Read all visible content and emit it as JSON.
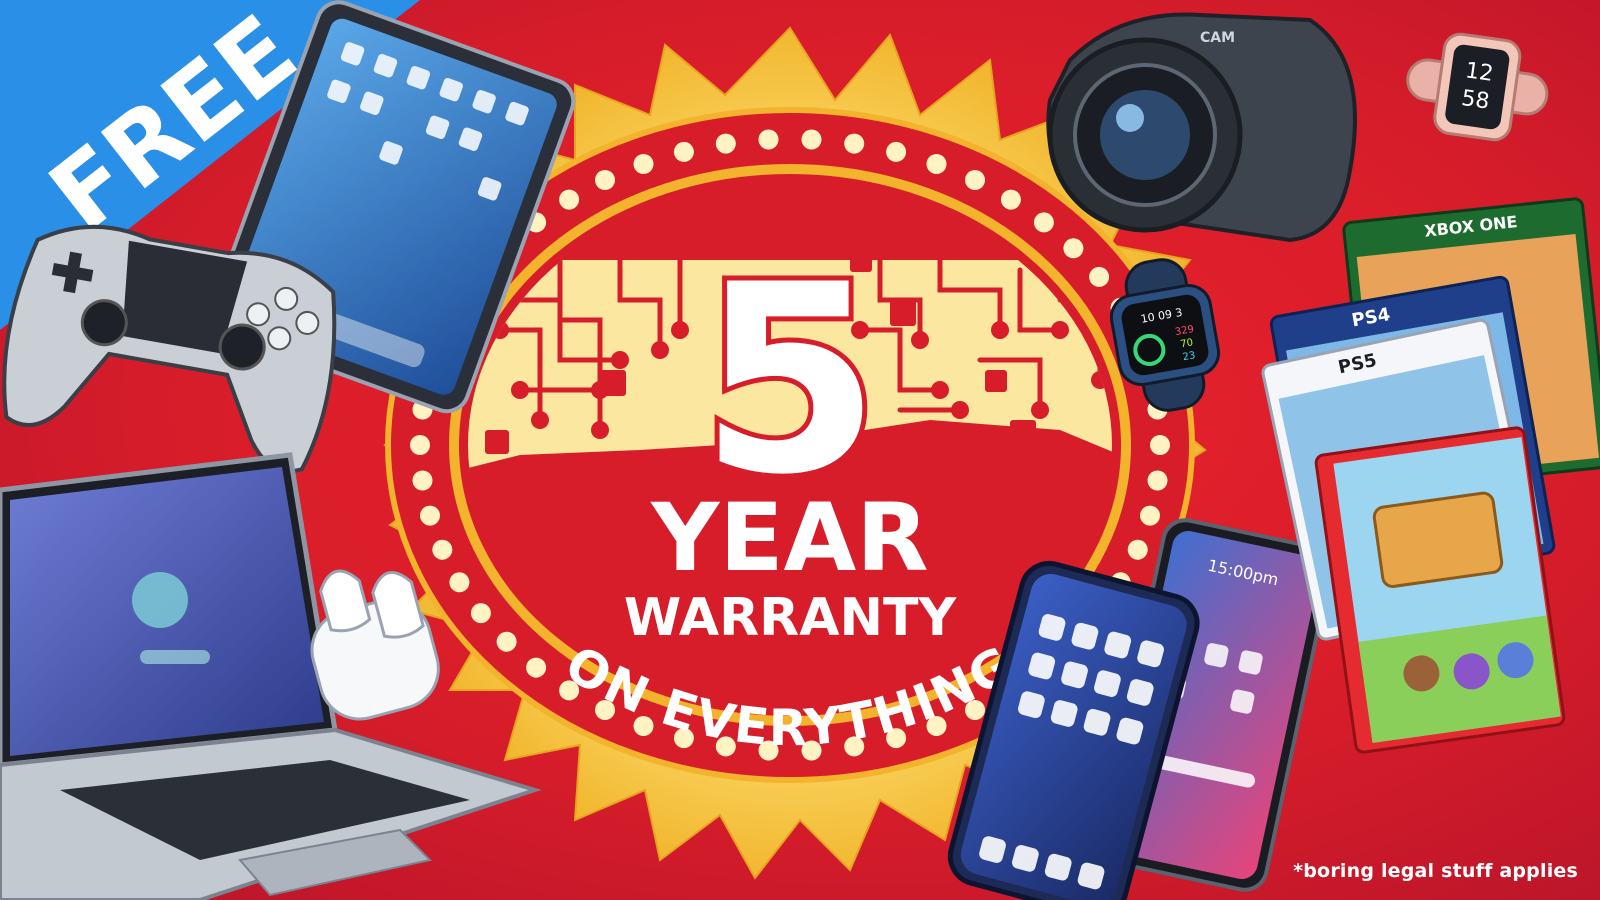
{
  "banner": {
    "free_label": "FREE",
    "number": "5",
    "year_label": "YEAR",
    "warranty_label": "WARRANTY",
    "tagline": "ON EVERYTHING",
    "disclaimer": "*boring legal stuff applies"
  },
  "devices": {
    "camera_brand": "CAM",
    "smartwatch_time_hours": "12",
    "smartwatch_time_minutes": "58",
    "applewatch_time": "10 09 3",
    "applewatch_stat_1": "329",
    "applewatch_stat_2": "70",
    "applewatch_stat_3": "23",
    "phone_time": "15:00pm",
    "game_box_xbox": "XBOX ONE",
    "game_box_ps": "PS4",
    "game_box_ps2": "PS5"
  },
  "colors": {
    "background_red": "#d81d2a",
    "free_band_blue": "#2a8fe6",
    "burst_yellow": "#f7c948",
    "burst_light": "#fbe7a0",
    "seal_red": "#d81d2a",
    "text_white": "#ffffff"
  },
  "icons": {
    "free_banner": "diagonal-ribbon",
    "seal": "starburst-badge",
    "circuit": "circuit-board-pattern"
  }
}
